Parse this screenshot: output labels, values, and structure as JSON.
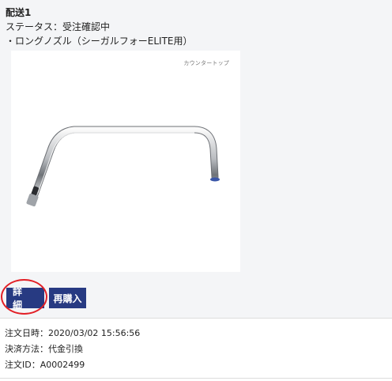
{
  "shipment": {
    "title": "配送1",
    "status": "ステータス：受注確認中",
    "item_name": "・ロングノズル（シーガルフォーELITE用）",
    "image_caption": "カウンタートップ"
  },
  "buttons": {
    "detail": "詳細",
    "rebuy": "再購入"
  },
  "order": {
    "datetime": "注文日時：2020/03/02 15:56:56",
    "payment": "決済方法：代金引換",
    "order_id": "注文ID：A0002499"
  },
  "colors": {
    "button_bg": "#273a82",
    "highlight": "#e21f26",
    "section_bg": "#f4f5f7"
  }
}
